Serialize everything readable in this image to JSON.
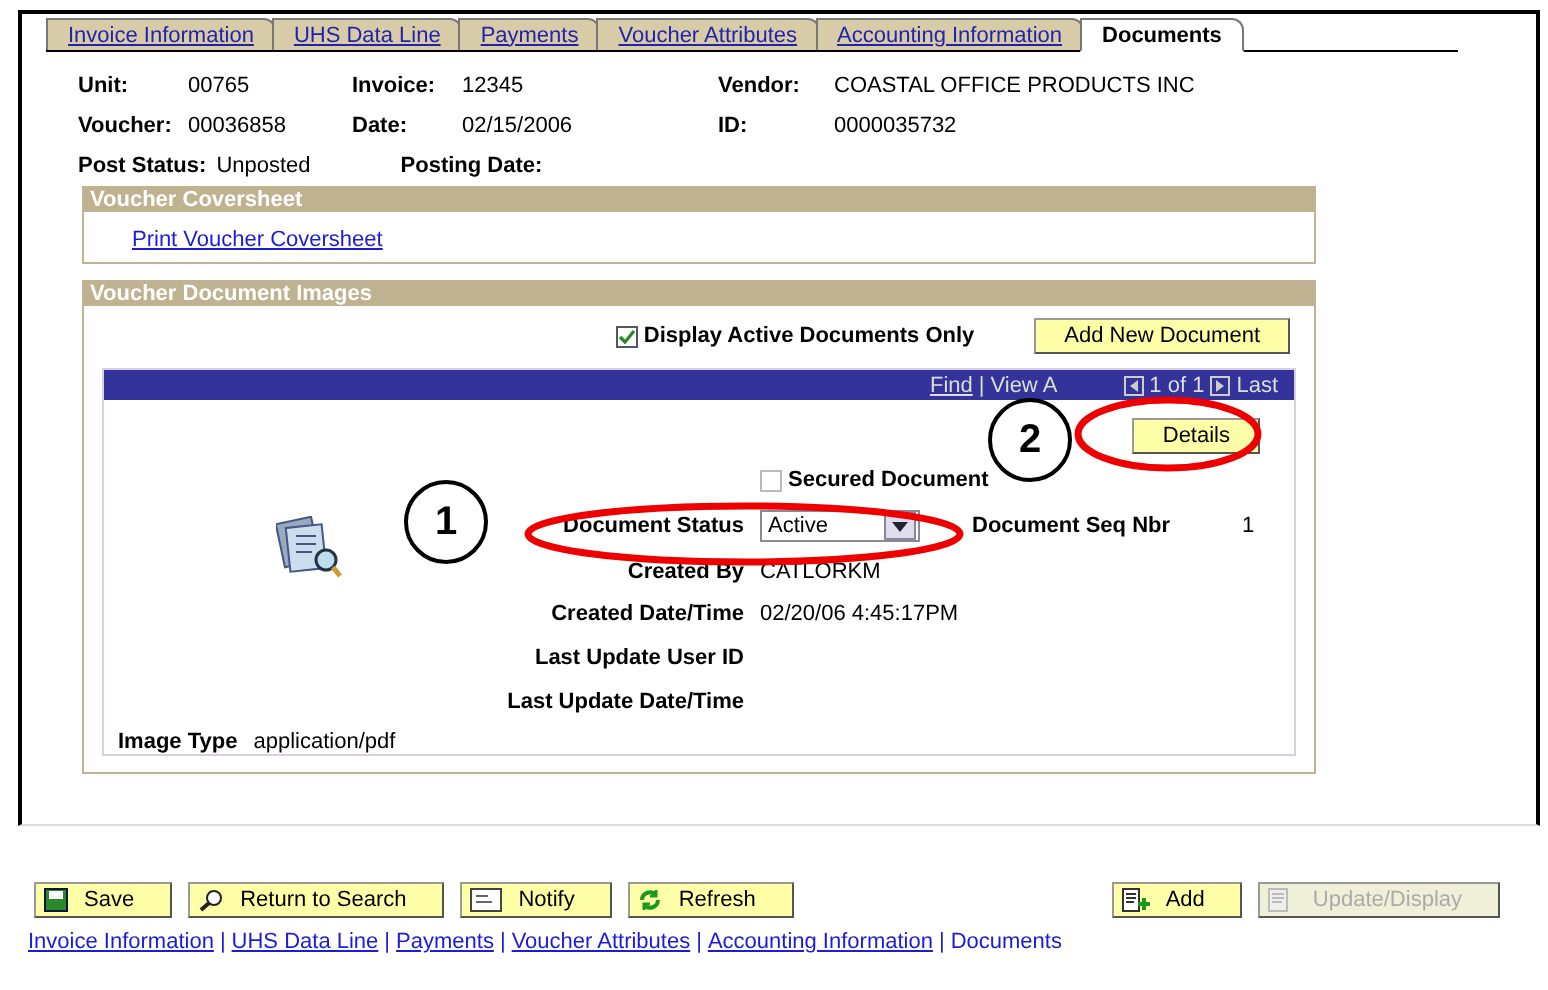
{
  "tabs": [
    {
      "label": "Invoice Information",
      "selected": false
    },
    {
      "label": "UHS Data Line",
      "selected": false
    },
    {
      "label": "Payments",
      "selected": false
    },
    {
      "label": "Voucher Attributes",
      "selected": false
    },
    {
      "label": "Accounting Information",
      "selected": false
    },
    {
      "label": "Documents",
      "selected": true
    }
  ],
  "header_fields": [
    [
      {
        "label": "Unit:",
        "value": "00765"
      },
      {
        "label": "Invoice:",
        "value": "12345"
      },
      {
        "label": "Vendor:",
        "value": "COASTAL OFFICE PRODUCTS INC"
      }
    ],
    [
      {
        "label": "Voucher:",
        "value": "00036858"
      },
      {
        "label": "Date:",
        "value": "02/15/2006"
      },
      {
        "label": "ID:",
        "value": "0000035732"
      }
    ],
    [
      {
        "label": "Post Status:",
        "value": "Unposted"
      },
      {
        "label": "Posting Date:"
      }
    ]
  ],
  "coversheet": {
    "title": "Voucher Coversheet",
    "link": "Print Voucher Coversheet"
  },
  "document_images": {
    "title": "Voucher Document Images",
    "active_only": {
      "label": "Display Active Documents Only",
      "checked": true
    },
    "add_button": "Add New Document",
    "grid_nav": {
      "find": "Find",
      "separator": "|",
      "view": "View A",
      "count": "1 of 1",
      "last": "Last"
    },
    "details_button": "Details",
    "secured": {
      "label": "Secured Document",
      "checked": false
    },
    "status": {
      "label": "Document Status",
      "value": "Active"
    },
    "seq": {
      "label": "Document Seq Nbr",
      "value": "1"
    },
    "rows": [
      {
        "label": "Created By",
        "value": "CATLORKM"
      },
      {
        "label": "Created Date/Time",
        "value": "02/20/06  4:45:17PM"
      },
      {
        "label": "Last Update User ID"
      },
      {
        "label": "Last Update Date/Time"
      }
    ],
    "image_type": {
      "label": "Image Type",
      "value": "application/pdf"
    }
  },
  "callouts": [
    "1",
    "2"
  ],
  "toolbar": {
    "left": [
      {
        "label": "Save",
        "kind": "save",
        "disabled": false
      },
      {
        "label": "Return to Search",
        "kind": "search",
        "disabled": false
      },
      {
        "label": "Notify",
        "kind": "notify",
        "disabled": false
      },
      {
        "label": "Refresh",
        "kind": "refresh",
        "disabled": false
      }
    ],
    "right": [
      {
        "label": "Add",
        "kind": "add",
        "disabled": false
      },
      {
        "label": "Update/Display",
        "kind": "update",
        "disabled": true
      }
    ]
  },
  "bottom_links": {
    "separator": "|",
    "items": [
      {
        "label": "Invoice Information",
        "current": false
      },
      {
        "label": "UHS Data Line",
        "current": false
      },
      {
        "label": "Payments",
        "current": false
      },
      {
        "label": "Voucher Attributes",
        "current": false
      },
      {
        "label": "Accounting Information",
        "current": false
      },
      {
        "label": "Documents",
        "current": true
      }
    ]
  }
}
